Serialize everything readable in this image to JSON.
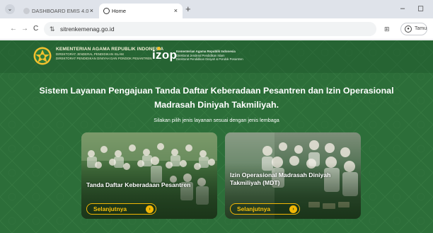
{
  "browser": {
    "tab_menu_icon": "chevron-down",
    "tabs": [
      {
        "label": "DASHBOARD EMIS 4.0",
        "active": false
      },
      {
        "label": "Home",
        "active": true
      }
    ],
    "tab_close_glyph": "×",
    "new_tab_glyph": "+",
    "window_controls": {
      "minimize": "–",
      "restore": "◻"
    },
    "nav": {
      "back": "←",
      "forward": "→",
      "reload": "C"
    },
    "url": "sitrenkemenag.go.id",
    "site_info_icon": "tune-icon",
    "profile_label": "Tamu"
  },
  "header": {
    "kemenag_line1": "KEMENTERIAN AGAMA REPUBLIK INDONESIA",
    "kemenag_line2": "DIREKTORAT JENDERAL PENDIDIKAN ISLAM",
    "kemenag_line3": "DIREKTORAT PENDIDIKAN DINIYAH DAN PONDOK PESANTREN",
    "izop_logo": "izop",
    "izop_line1": "Kementerian Agama Republik Indonesia",
    "izop_line2": "Direktorat Jenderal Pendidikan Islam",
    "izop_line3": "Direktorat Pendidikan Diniyah & Pondok Pesantren"
  },
  "hero": {
    "title": "Sistem Layanan Pengajuan Tanda Daftar Keberadaan Pesantren dan Izin Operasional Madrasah Diniyah Takmiliyah.",
    "subtitle": "Silakan pilih jenis layanan sesuai dengan jenis lembaga"
  },
  "cards": [
    {
      "title": "Tanda Daftar Keberadaan Pesantren",
      "button": "Selanjutnya",
      "arrow": "›"
    },
    {
      "title": "Izin Operasional Madrasah Diniyah Takmiliyah (MDT)",
      "button": "Selanjutnya",
      "arrow": "›"
    }
  ],
  "colors": {
    "page_green": "#2c6e39",
    "accent_gold": "#f2b705",
    "tabbar": "#dfe3ea"
  }
}
